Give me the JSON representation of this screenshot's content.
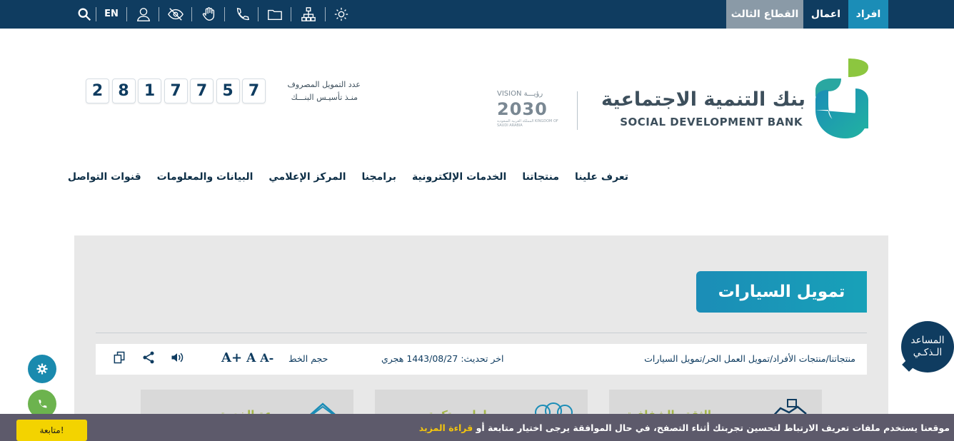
{
  "topbar": {
    "segments": [
      "افراد",
      "اعمال",
      "القطاع الثالث"
    ],
    "lang": "EN"
  },
  "header": {
    "bank_name_ar": "بنك التنمية الاجتماعية",
    "bank_name_en": "SOCIAL DEVELOPMENT BANK",
    "vision_top": "VISION رؤيـــة",
    "vision_year": "2030",
    "vision_sub": "المملكة العربية السعودية KINGDOM OF SAUDI ARABIA",
    "counter_label_1": "عدد التمويل المصروف",
    "counter_label_2": "منـذ تأسيـس البنـــك",
    "digits": [
      "2",
      "8",
      "1",
      "7",
      "7",
      "5",
      "7"
    ]
  },
  "nav": [
    "تعرف علينا",
    "منتجاتنا",
    "الخدمات الإلكترونية",
    "برامجنا",
    "المركز الإعلامي",
    "البيانات والمعلومات",
    "قنوات التواصل"
  ],
  "page": {
    "title": "تمويل السيارات",
    "breadcrumb": "منتجاتنا/منتجات الأفراد/تمويل العمل الحر/تمويل السيارات",
    "updated": "اخر تحديث: 1443/08/27 هجري",
    "font_size_label": "حجم الخط",
    "font_plus": "A+",
    "font_normal": "A",
    "font_minus": "A-",
    "cards": [
      "الثقة والشفافية",
      "حلول مبتكرة",
      "سرعة الخدمة"
    ]
  },
  "assistant": {
    "line1": "المساعد",
    "line2": "الـذكـي"
  },
  "cookie": {
    "text": "موقعنا يستخدم ملفات تعريف الارتباط لتحسين تجربتك أثناء التصفح، في حال الموافقة يرجى اختيار متابعة أو ",
    "link": "قراءة المزيد",
    "button": "متابعة!"
  }
}
